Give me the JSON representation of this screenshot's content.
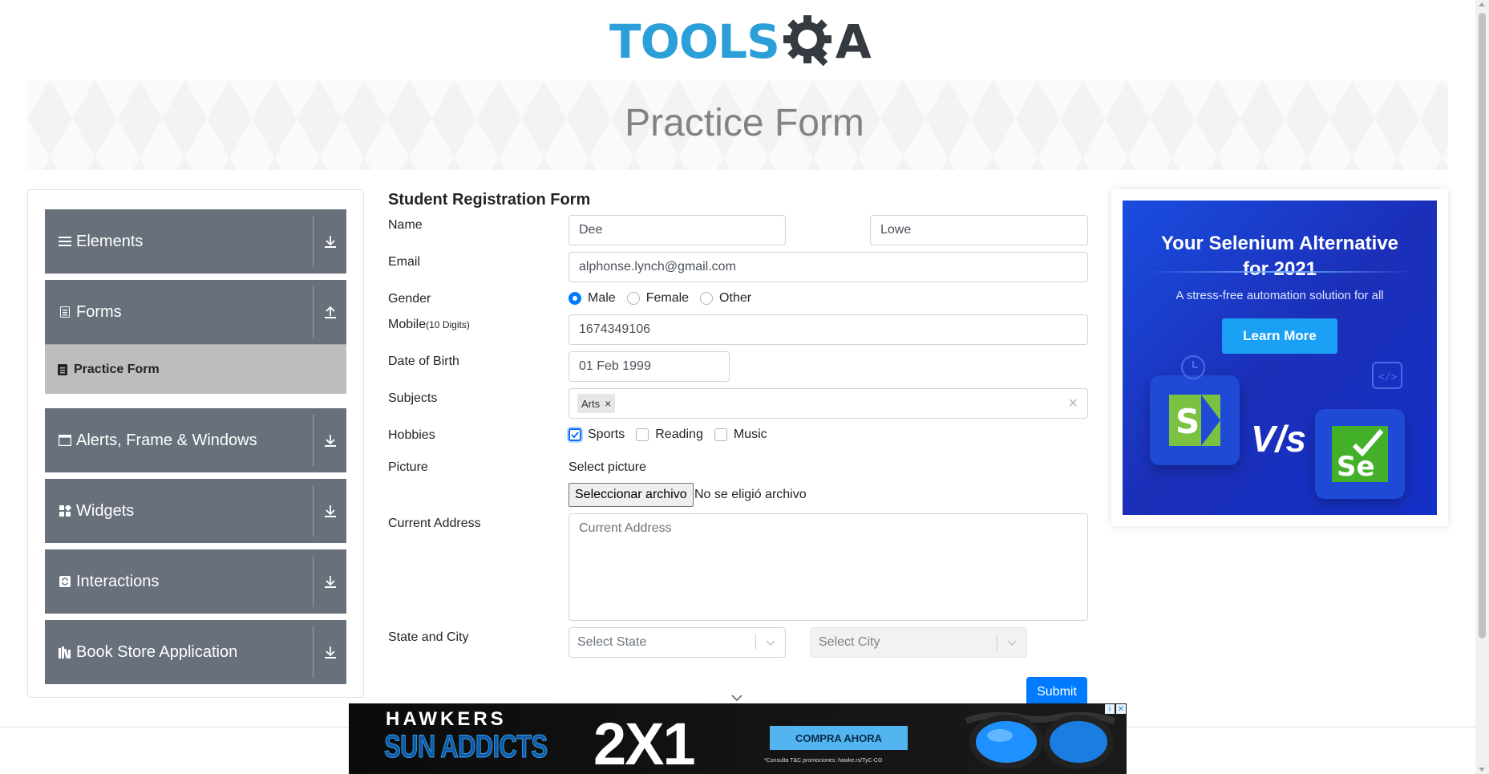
{
  "logo": {
    "part1": "TOOLS",
    "part2": "A"
  },
  "banner": {
    "title": "Practice Form"
  },
  "sidebar": {
    "groups": [
      {
        "label": "Elements",
        "icon": "menu-icon",
        "expanded": false
      },
      {
        "label": "Forms",
        "icon": "document-icon",
        "expanded": true,
        "subitems": [
          {
            "label": "Practice Form",
            "active": true
          }
        ]
      },
      {
        "label": "Alerts, Frame & Windows",
        "icon": "window-icon",
        "expanded": false
      },
      {
        "label": "Widgets",
        "icon": "grid-icon",
        "expanded": false
      },
      {
        "label": "Interactions",
        "icon": "refresh-icon",
        "expanded": false
      },
      {
        "label": "Book Store Application",
        "icon": "books-icon",
        "expanded": false
      }
    ]
  },
  "form": {
    "title": "Student Registration Form",
    "name_label": "Name",
    "first_name": "Dee",
    "last_name": "Lowe",
    "email_label": "Email",
    "email": "alphonse.lynch@gmail.com",
    "gender_label": "Gender",
    "gender_options": [
      "Male",
      "Female",
      "Other"
    ],
    "gender_selected": "Male",
    "mobile_label": "Mobile",
    "mobile_hint": "(10 Digits)",
    "mobile": "1674349106",
    "dob_label": "Date of Birth",
    "dob": "01 Feb 1999",
    "subjects_label": "Subjects",
    "subjects": [
      "Arts"
    ],
    "hobbies_label": "Hobbies",
    "hobbies": [
      {
        "label": "Sports",
        "checked": true
      },
      {
        "label": "Reading",
        "checked": false
      },
      {
        "label": "Music",
        "checked": false
      }
    ],
    "picture_label": "Picture",
    "picture_hint": "Select picture",
    "file_button": "Seleccionar archivo",
    "file_status": "No se eligió archivo",
    "address_label": "Current Address",
    "address_placeholder": "Current Address",
    "state_city_label": "State and City",
    "state_placeholder": "Select State",
    "city_placeholder": "Select City",
    "submit_label": "Submit"
  },
  "ad_right": {
    "headline_line1": "Your Selenium Alternative",
    "headline_line2": "for 2021",
    "subtitle": "A stress-free automation solution for all",
    "cta": "Learn More",
    "vs": "V/s",
    "logo_left": "S",
    "logo_right": "Se",
    "colors": {
      "background": "#1b3fd1",
      "button": "#1aa1f5"
    }
  },
  "ad_bottom": {
    "brand": "HAWKERS",
    "tagline": "SUN ADDICTS",
    "offer": "2X1",
    "cta": "COMPRA AHORA",
    "fine_print": "*Consulta T&C promociones: hawke.rs/TyC-CO"
  },
  "colors": {
    "accent": "#007bff",
    "sidebar": "#68707b",
    "active_item": "#bdbdbd",
    "logo_blue": "#2b9fd8"
  }
}
